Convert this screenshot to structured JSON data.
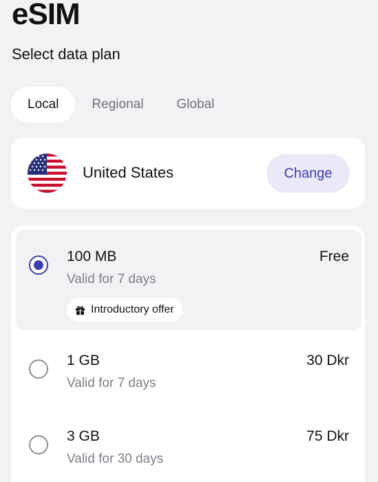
{
  "header": {
    "title": "eSIM",
    "subtitle": "Select data plan"
  },
  "tabs": [
    {
      "label": "Local",
      "active": true
    },
    {
      "label": "Regional",
      "active": false
    },
    {
      "label": "Global",
      "active": false
    }
  ],
  "country": {
    "name": "United States",
    "flag_icon": "us-flag-icon",
    "change_label": "Change"
  },
  "plans": [
    {
      "size": "100 MB",
      "validity": "Valid for 7 days",
      "price": "Free",
      "selected": true,
      "badge": "Introductory offer",
      "badge_icon": "gift-icon"
    },
    {
      "size": "1 GB",
      "validity": "Valid for 7 days",
      "price": "30 Dkr",
      "selected": false
    },
    {
      "size": "3 GB",
      "validity": "Valid for 30 days",
      "price": "75 Dkr",
      "selected": false
    }
  ],
  "colors": {
    "accent": "#3b3fb0",
    "accent_bg": "#e9e9f8",
    "background": "#f2f2f4"
  }
}
